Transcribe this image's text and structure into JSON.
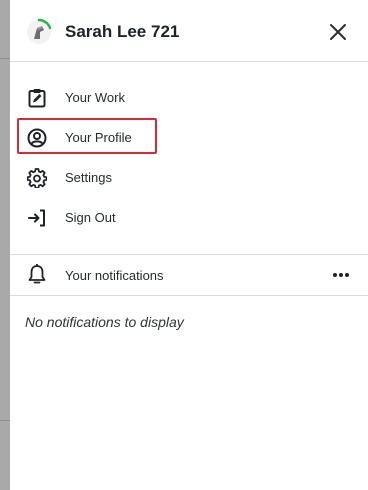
{
  "header": {
    "user_name": "Sarah Lee 721",
    "avatar_icon": "user-avatar-icon",
    "close_icon": "close-icon"
  },
  "menu": {
    "items": [
      {
        "label": "Your Work",
        "icon": "clipboard-edit-icon"
      },
      {
        "label": "Your Profile",
        "icon": "user-circle-icon"
      },
      {
        "label": "Settings",
        "icon": "gear-icon"
      },
      {
        "label": "Sign Out",
        "icon": "sign-out-icon"
      }
    ],
    "highlighted_item": "Your Profile"
  },
  "notifications": {
    "title": "Your notifications",
    "bell_icon": "bell-icon",
    "more_icon": "more-horizontal-icon",
    "empty_message": "No notifications to display"
  },
  "colors": {
    "highlight": "#d42b35",
    "avatar_ring": "#2bb34a",
    "text": "#1f2328"
  }
}
